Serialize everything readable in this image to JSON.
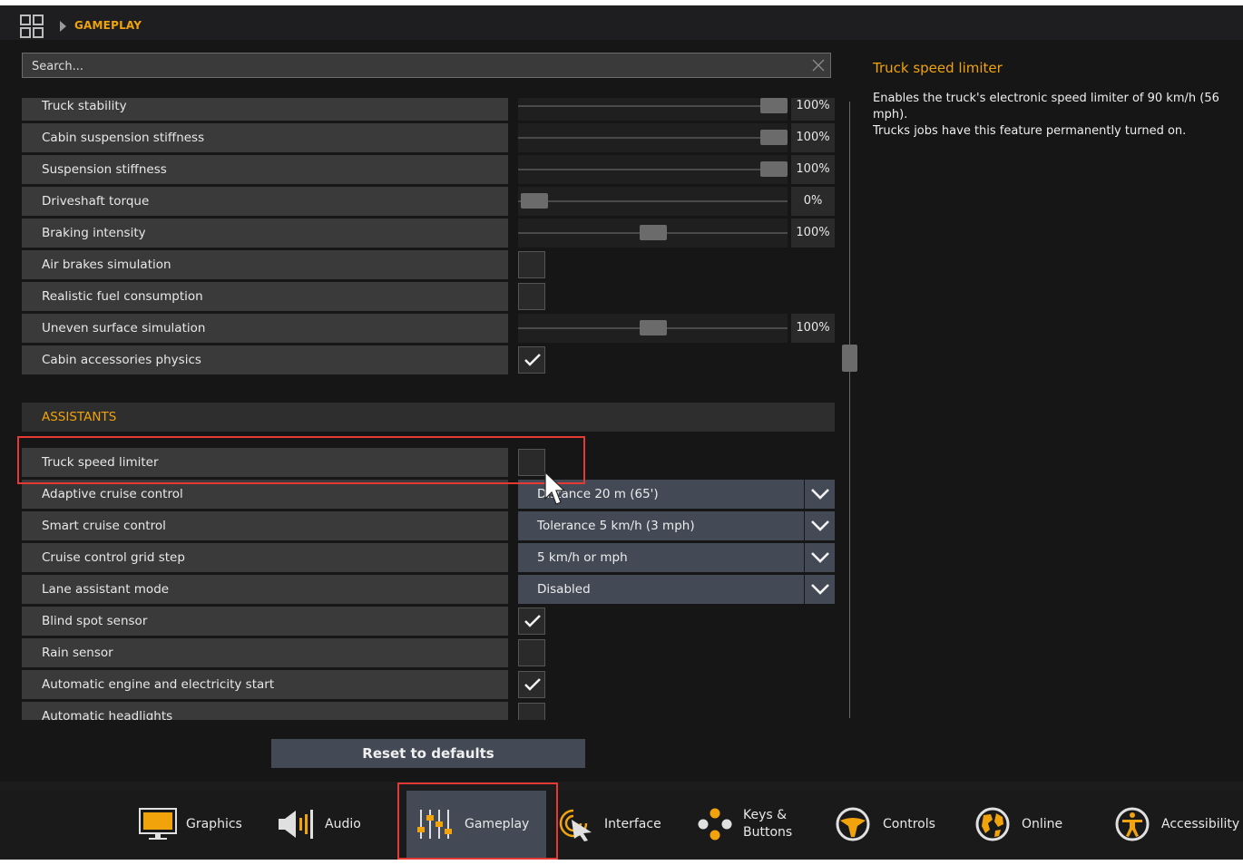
{
  "breadcrumb": {
    "section": "GAMEPLAY"
  },
  "search": {
    "placeholder": "Search..."
  },
  "settings": {
    "truck_stability": {
      "label": "Truck stability",
      "value": "100%",
      "level": 0.95
    },
    "cabin_suspension": {
      "label": "Cabin suspension stiffness",
      "value": "100%",
      "level": 0.95
    },
    "suspension": {
      "label": "Suspension stiffness",
      "value": "100%",
      "level": 0.95
    },
    "driveshaft": {
      "label": "Driveshaft torque",
      "value": "0%",
      "level": 0.06
    },
    "braking": {
      "label": "Braking intensity",
      "value": "100%",
      "level": 0.5
    },
    "air_brakes": {
      "label": "Air brakes simulation",
      "checked": false
    },
    "fuel": {
      "label": "Realistic fuel consumption",
      "checked": false
    },
    "uneven": {
      "label": "Uneven surface simulation",
      "value": "100%",
      "level": 0.5
    },
    "cabin_accessories": {
      "label": "Cabin accessories physics",
      "checked": true
    }
  },
  "assistants": {
    "header": "ASSISTANTS",
    "speed_limiter": {
      "label": "Truck speed limiter",
      "checked": false
    },
    "acc": {
      "label": "Adaptive cruise control",
      "value": "Distance 20 m (65')"
    },
    "smart_cruise": {
      "label": "Smart cruise control",
      "value": "Tolerance 5 km/h (3 mph)"
    },
    "grid_step": {
      "label": "Cruise control grid step",
      "value": "5 km/h or mph"
    },
    "lane_assist": {
      "label": "Lane assistant mode",
      "value": "Disabled"
    },
    "blind_spot": {
      "label": "Blind spot sensor",
      "checked": true
    },
    "rain": {
      "label": "Rain sensor",
      "checked": false
    },
    "auto_start": {
      "label": "Automatic engine and electricity start",
      "checked": true
    },
    "auto_headlights": {
      "label": "Automatic headlights",
      "checked": false
    }
  },
  "info": {
    "title": "Truck speed limiter",
    "description": "Enables the truck's electronic speed limiter of 90 km/h (56 mph).\nTrucks jobs have this feature permanently turned on."
  },
  "reset_label": "Reset to defaults",
  "tabs": {
    "graphics": "Graphics",
    "audio": "Audio",
    "gameplay": "Gameplay",
    "interface": "Interface",
    "keys_line1": "Keys &",
    "keys_line2": "Buttons",
    "controls": "Controls",
    "online": "Online",
    "accessibility": "Accessibility"
  },
  "colors": {
    "accent": "#f0a30a",
    "highlight": "#e53935",
    "active_tab": "#434a55"
  }
}
